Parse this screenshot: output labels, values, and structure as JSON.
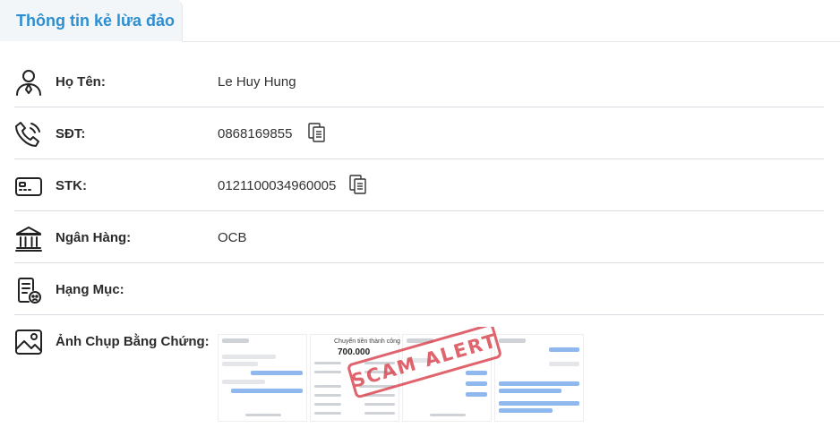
{
  "tab": {
    "title": "Thông tin kẻ lừa đảo"
  },
  "rows": [
    {
      "label": "Họ Tên:",
      "value": "Le Huy Hung"
    },
    {
      "label": "SĐT:",
      "value": "0868169855"
    },
    {
      "label": "STK:",
      "value": "0121100034960005"
    },
    {
      "label": "Ngân Hàng:",
      "value": "OCB"
    },
    {
      "label": "Hạng Mục:",
      "value": ""
    },
    {
      "label": "Ảnh Chụp Bằng Chứng:",
      "value": ""
    }
  ],
  "evidence": {
    "stamp_text": "SCAM ALERT",
    "transfer_title": "Chuyển tiền thành công",
    "transfer_amount": "700.000"
  },
  "icons": {
    "name": "person-icon",
    "phone": "phone-icon",
    "account": "card-icon",
    "bank": "bank-icon",
    "category": "category-icon",
    "evidence": "image-icon",
    "copy": "copy-icon"
  },
  "colors": {
    "accent": "#2d8fd0",
    "stamp": "#d9434e"
  }
}
